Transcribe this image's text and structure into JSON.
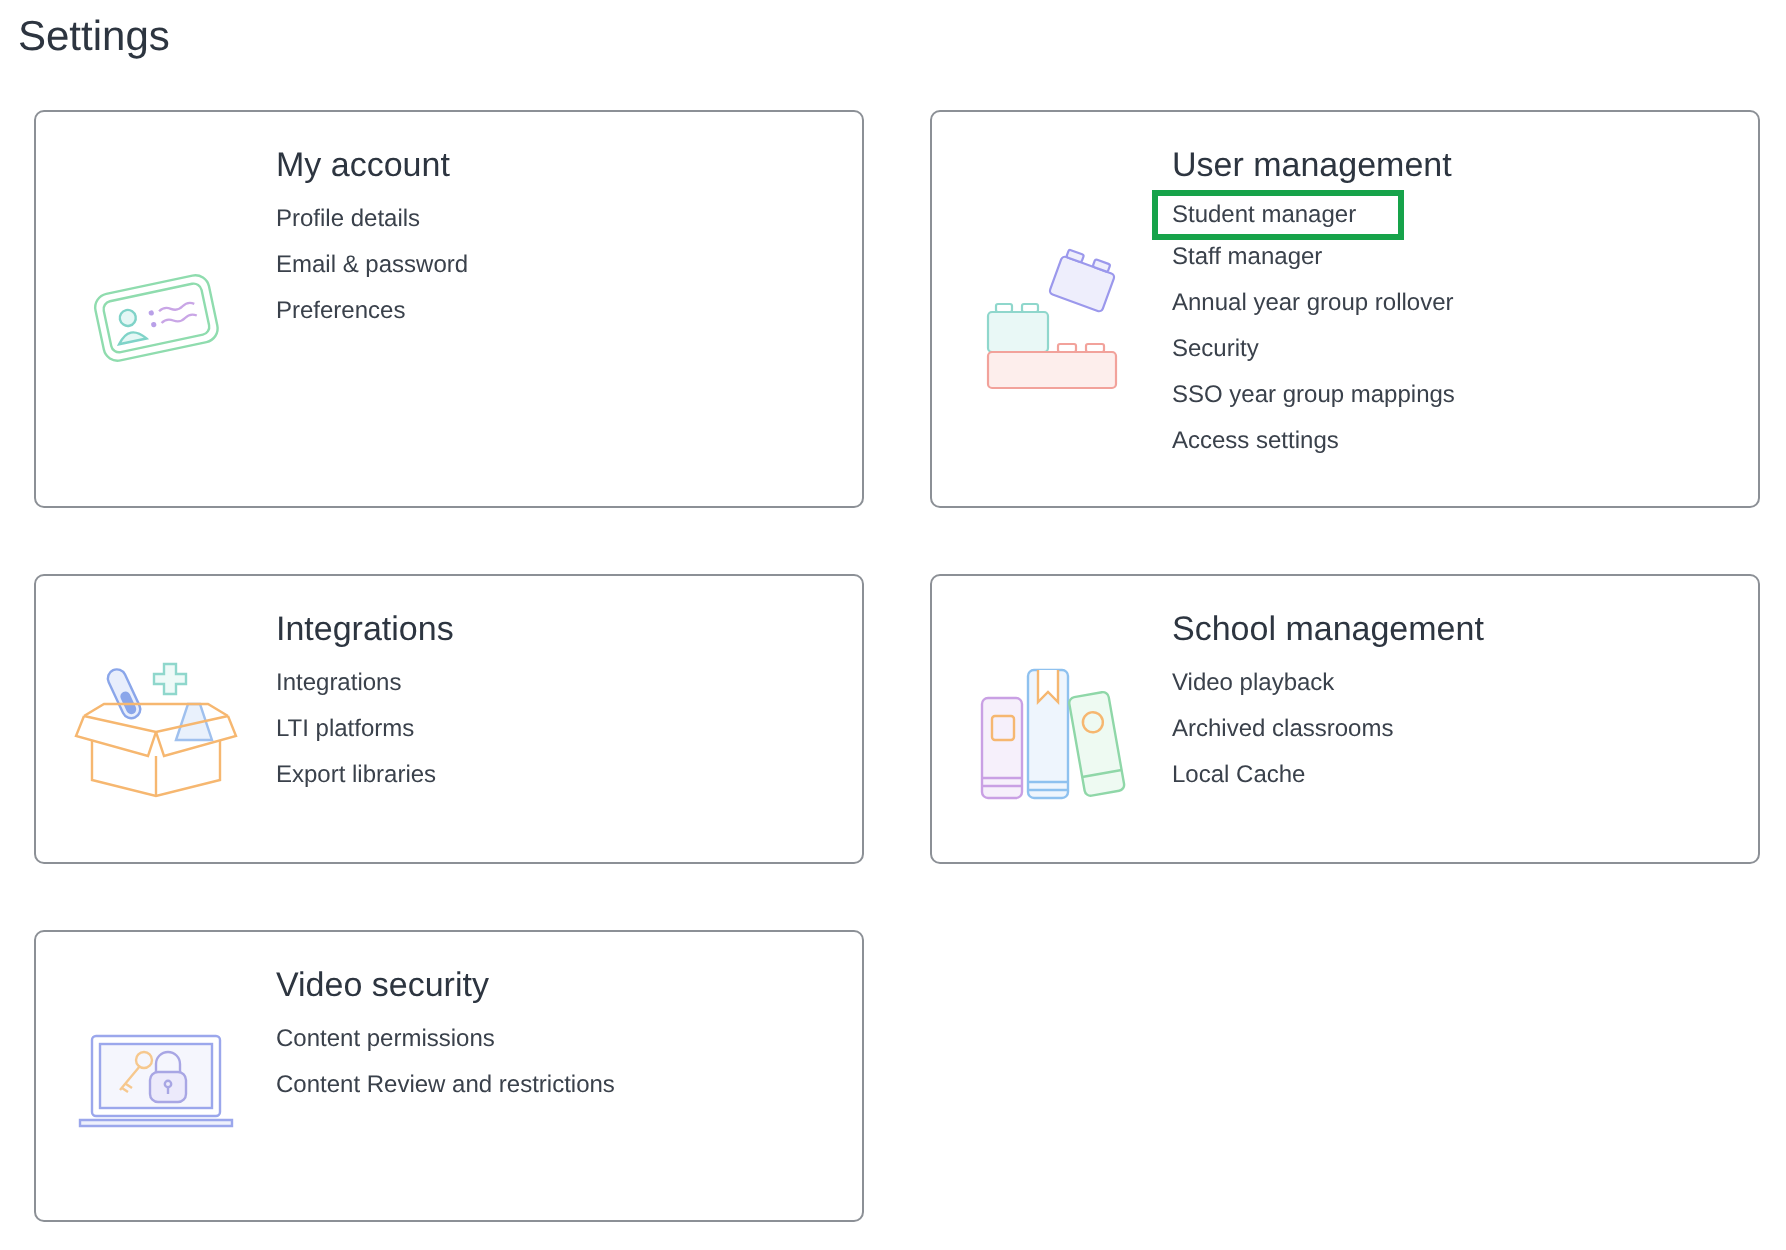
{
  "title": "Settings",
  "cards": [
    {
      "heading": "My account",
      "kind": "id-card",
      "links": [
        {
          "label": "Profile details",
          "highlighted": false
        },
        {
          "label": "Email & password",
          "highlighted": false
        },
        {
          "label": "Preferences",
          "highlighted": false
        }
      ]
    },
    {
      "heading": "User management",
      "kind": "blocks",
      "links": [
        {
          "label": "Student manager",
          "highlighted": true
        },
        {
          "label": "Staff manager",
          "highlighted": false
        },
        {
          "label": "Annual year group rollover",
          "highlighted": false
        },
        {
          "label": "Security",
          "highlighted": false
        },
        {
          "label": "SSO year group mappings",
          "highlighted": false
        },
        {
          "label": "Access settings",
          "highlighted": false
        }
      ]
    },
    {
      "heading": "Integrations",
      "kind": "box",
      "links": [
        {
          "label": "Integrations",
          "highlighted": false
        },
        {
          "label": "LTI platforms",
          "highlighted": false
        },
        {
          "label": "Export libraries",
          "highlighted": false
        }
      ]
    },
    {
      "heading": "School management",
      "kind": "books",
      "links": [
        {
          "label": "Video playback",
          "highlighted": false
        },
        {
          "label": "Archived classrooms",
          "highlighted": false
        },
        {
          "label": "Local Cache",
          "highlighted": false
        }
      ]
    },
    {
      "heading": "Video security",
      "kind": "laptop",
      "links": [
        {
          "label": "Content permissions",
          "highlighted": false
        },
        {
          "label": "Content Review and restrictions",
          "highlighted": false
        }
      ]
    }
  ]
}
